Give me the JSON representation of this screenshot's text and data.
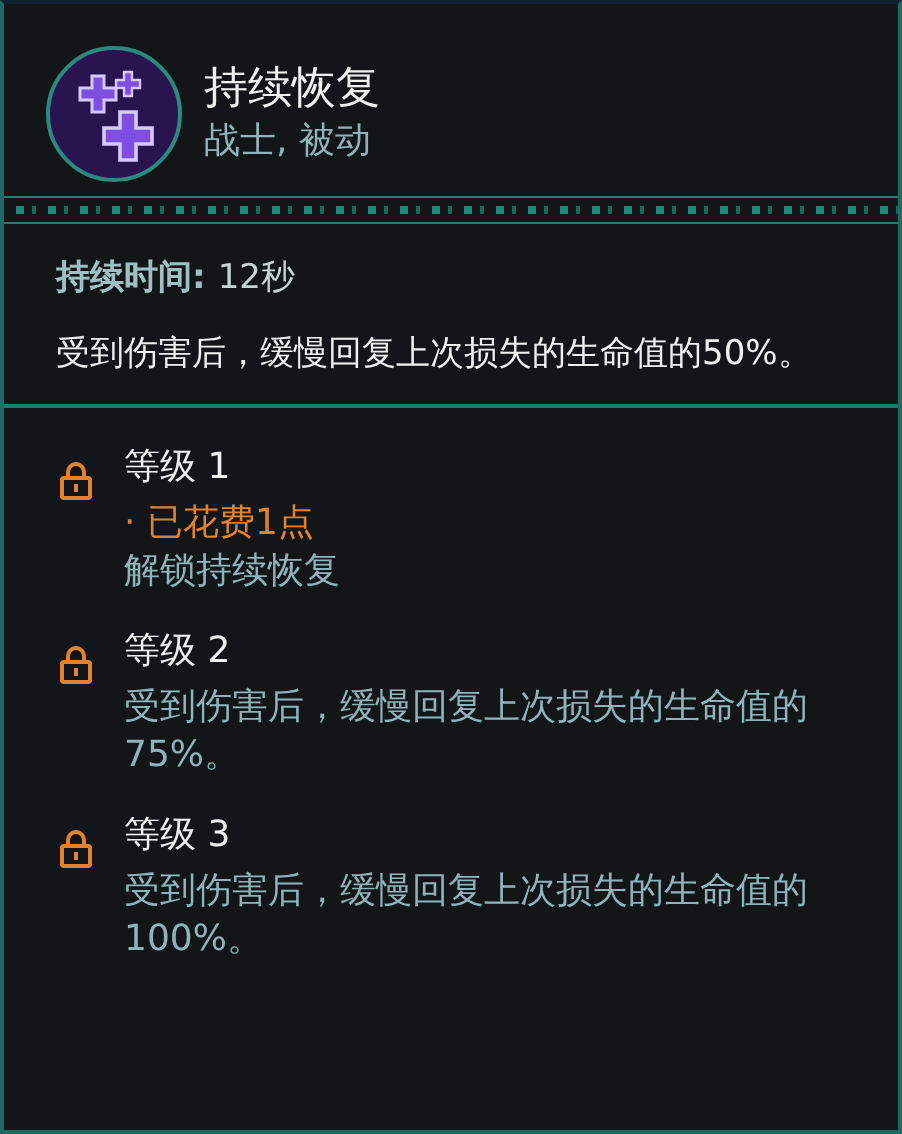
{
  "talent": {
    "title": "持续恢复",
    "subtitle": "战士, 被动"
  },
  "duration": {
    "label": "持续时间:",
    "value": "12秒"
  },
  "description": "受到伤害后，缓慢回复上次损失的生命值的50%。",
  "levels": [
    {
      "title": "等级 1",
      "locked": true,
      "note": "· 已花费1点",
      "description": "解锁持续恢复"
    },
    {
      "title": "等级 2",
      "locked": true,
      "description": "受到伤害后，缓慢回复上次损失的生命值的75%。"
    },
    {
      "title": "等级 3",
      "locked": true,
      "description": "受到伤害后，缓慢回复上次损失的生命值的100%。"
    }
  ]
}
